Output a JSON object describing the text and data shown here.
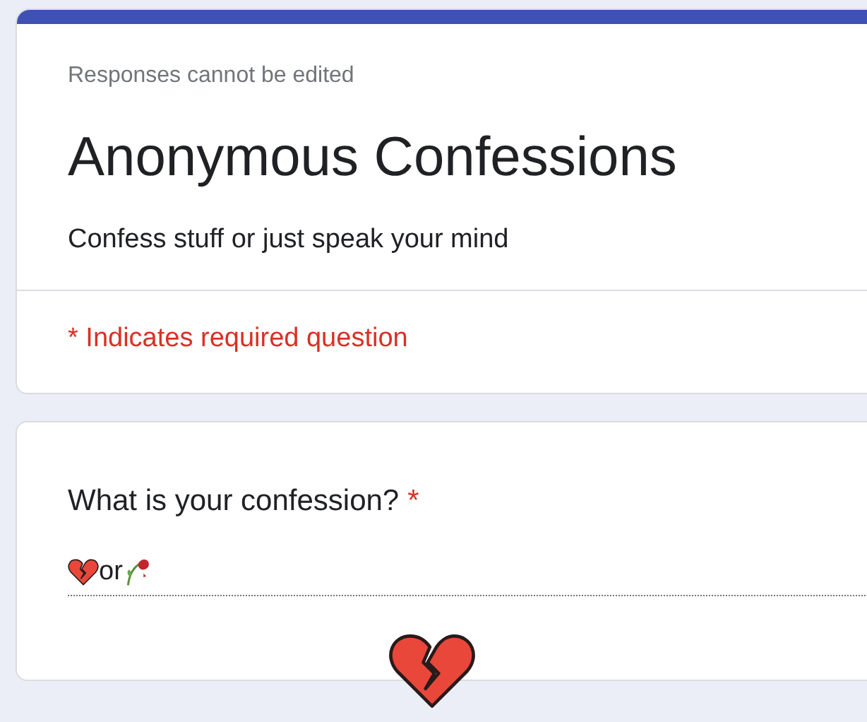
{
  "header_card": {
    "notice": "Responses cannot be edited",
    "title": "Anonymous Confessions",
    "description": "Confess stuff or just speak your mind",
    "required_note": "* Indicates required question"
  },
  "question_card": {
    "question": "What is your confession?",
    "required": true,
    "required_mark": "*",
    "answer": {
      "value": "or"
    }
  }
}
